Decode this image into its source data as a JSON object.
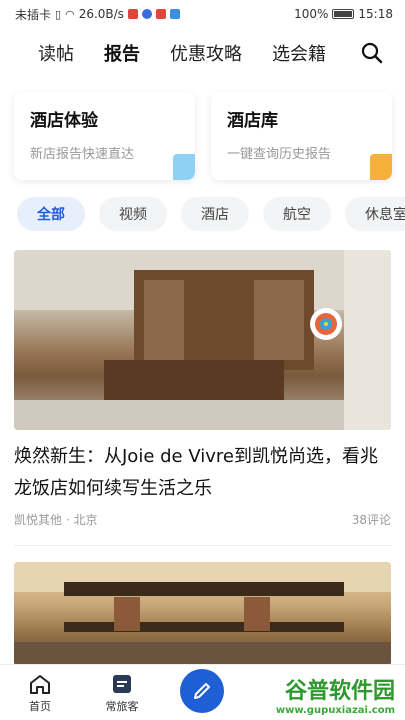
{
  "status_bar": {
    "carrier": "未插卡",
    "speed": "26.0B/s",
    "battery": "100%",
    "time": "15:18"
  },
  "nav": {
    "tabs": [
      {
        "label": "读帖",
        "active": false
      },
      {
        "label": "报告",
        "active": true
      },
      {
        "label": "优惠攻略",
        "active": false
      },
      {
        "label": "选会籍",
        "active": false
      }
    ],
    "search_icon": "search-icon"
  },
  "cards": [
    {
      "title": "酒店体验",
      "subtitle": "新店报告快速直达",
      "icon_color": "#8fd0f5"
    },
    {
      "title": "酒店库",
      "subtitle": "一键查询历史报告",
      "icon_color": "#f5b13a"
    }
  ],
  "filters": [
    {
      "label": "全部",
      "active": true
    },
    {
      "label": "视频",
      "active": false
    },
    {
      "label": "酒店",
      "active": false
    },
    {
      "label": "航空",
      "active": false
    },
    {
      "label": "休息室",
      "active": false
    }
  ],
  "articles": [
    {
      "title": "焕然新生：从Joie de Vivre到凯悦尚选，看兆龙饭店如何续写生活之乐",
      "author": "凯悦其他",
      "location": "北京",
      "comments": "38评论"
    }
  ],
  "bottom_nav": {
    "home": "首页",
    "traveler": "常旅客"
  },
  "watermark": {
    "brand": "谷普软件园",
    "url": "www.gupuxiazai.com"
  },
  "colors": {
    "accent": "#1f5fd6"
  }
}
